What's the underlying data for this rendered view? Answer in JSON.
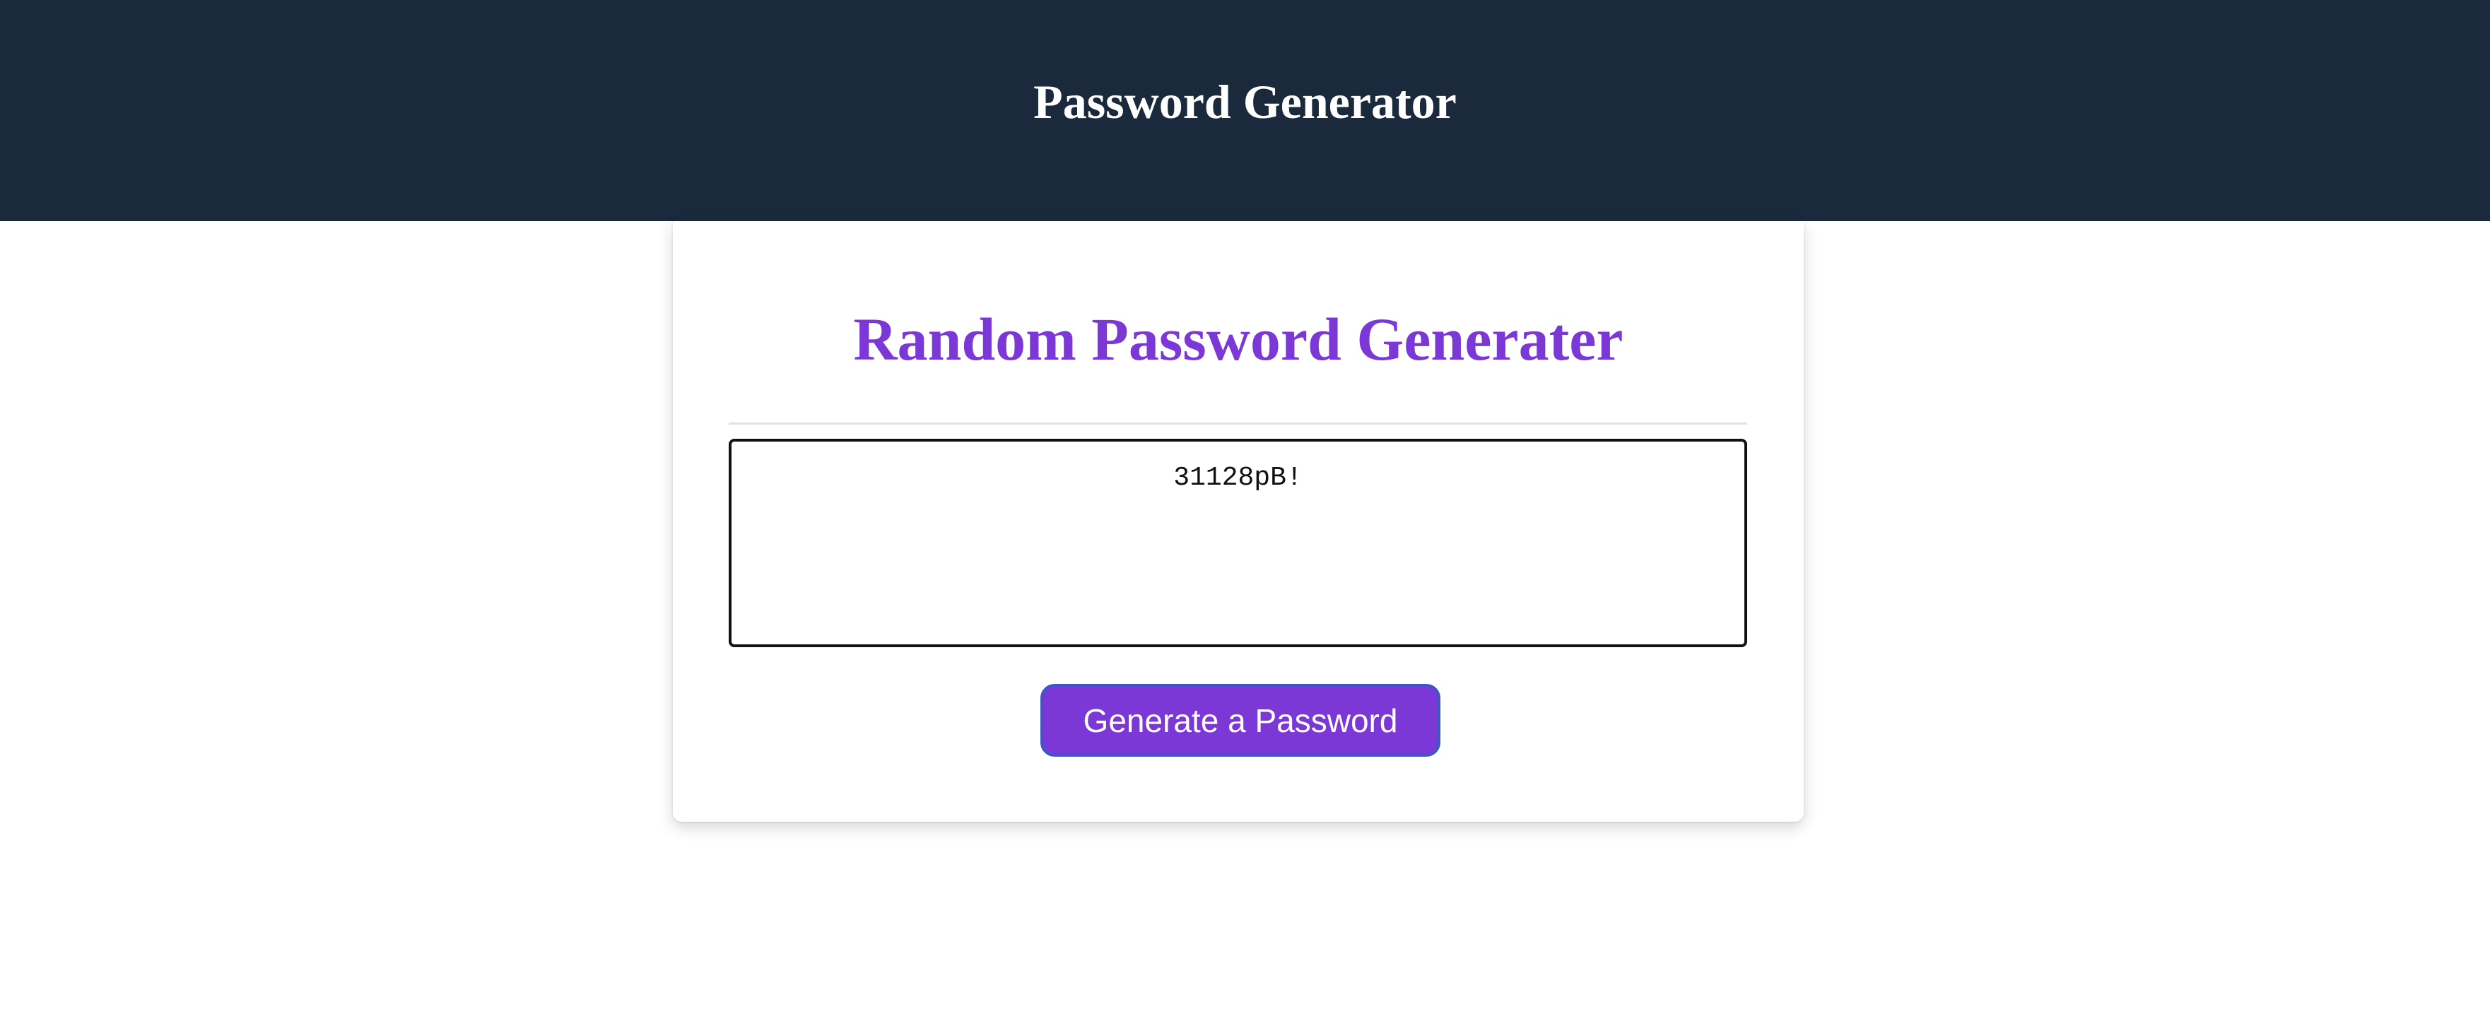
{
  "header": {
    "title": "Password Generator"
  },
  "card": {
    "title": "Random Password Generater",
    "password_value": "31128pB!",
    "generate_button_label": "Generate a Password"
  },
  "colors": {
    "header_background": "#1a293c",
    "accent": "#7c38d6",
    "button_border": "#3d56c5"
  }
}
